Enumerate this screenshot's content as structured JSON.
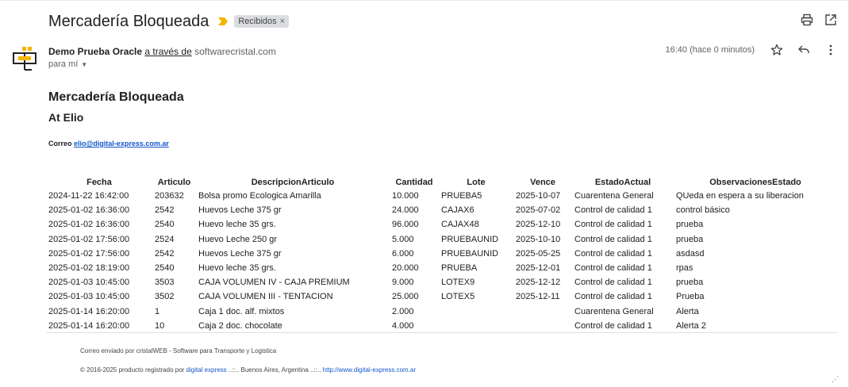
{
  "email": {
    "subject": "Mercadería Bloqueada",
    "label": "Recibidos",
    "sender_name": "Demo Prueba Oracle",
    "via_text": "a través de",
    "sender_domain": "softwarecristal.com",
    "to_text": "para mí",
    "time": "16:40 (hace 0 minutos)"
  },
  "body": {
    "title": "Mercadería Bloqueada",
    "subtitle": "At Elio",
    "contact_label": "Correo",
    "contact_email": "elio@digital-express.com.ar",
    "table": {
      "headers": [
        "Fecha",
        "Articulo",
        "DescripcionArticulo",
        "Cantidad",
        "Lote",
        "Vence",
        "EstadoActual",
        "ObservacionesEstado"
      ],
      "rows": [
        [
          "2024-11-22 16:42:00",
          "203632",
          "Bolsa promo Ecologica Amarilla",
          "10.000",
          "PRUEBA5",
          "2025-10-07",
          "Cuarentena General",
          "QUeda en espera a su liberacion"
        ],
        [
          "2025-01-02 16:36:00",
          "2542",
          "Huevos Leche 375 gr",
          "24.000",
          "CAJAX6",
          "2025-07-02",
          "Control de calidad 1",
          "control básico"
        ],
        [
          "2025-01-02 16:36:00",
          "2540",
          "Huevo leche 35 grs.",
          "96.000",
          "CAJAX48",
          "2025-12-10",
          "Control de calidad 1",
          "prueba"
        ],
        [
          "2025-01-02 17:56:00",
          "2524",
          "Huevo Leche 250 gr",
          "5.000",
          "PRUEBAUNID",
          "2025-10-10",
          "Control de calidad 1",
          "prueba"
        ],
        [
          "2025-01-02 17:56:00",
          "2542",
          "Huevos Leche 375 gr",
          "6.000",
          "PRUEBAUNID",
          "2025-05-25",
          "Control de calidad 1",
          "asdasd"
        ],
        [
          "2025-01-02 18:19:00",
          "2540",
          "Huevo leche 35 grs.",
          "20.000",
          "PRUEBA",
          "2025-12-01",
          "Control de calidad 1",
          "rpas"
        ],
        [
          "2025-01-03 10:45:00",
          "3503",
          "CAJA VOLUMEN IV - CAJA PREMIUM",
          "9.000",
          "LOTEX9",
          "2025-12-12",
          "Control de calidad 1",
          "prueba"
        ],
        [
          "2025-01-03 10:45:00",
          "3502",
          "CAJA VOLUMEN III - TENTACION",
          "25.000",
          "LOTEX5",
          "2025-12-11",
          "Control de calidad 1",
          "Prueba"
        ],
        [
          "2025-01-14 16:20:00",
          "1",
          "Caja 1 doc. alf. mixtos",
          "2.000",
          "",
          "",
          "Cuarentena General",
          "Alerta"
        ],
        [
          "2025-01-14 16:20:00",
          "10",
          "Caja 2 doc. chocolate",
          "4.000",
          "",
          "",
          "Control de calidad 1",
          "Alerta 2"
        ]
      ]
    },
    "footer_line1": "Correo enviado por cristalWEB - Software para Transporte y Logistica",
    "footer_prefix": "© 2016-2025 producto registrado por",
    "footer_link1": "digital express",
    "footer_mid": "..::.. Buenos Aires, Argentina ..::..",
    "footer_link2": "http://www.digital-express.com.ar"
  },
  "icons": {
    "importance": "importance-marker-icon",
    "print": "print-icon",
    "new_window": "open-in-new-window-icon",
    "star": "star-icon",
    "reply": "reply-icon",
    "more": "more-vert-icon"
  },
  "colors": {
    "link": "#1155cc",
    "importance": "#f4b400",
    "label_chip": "#dadce0"
  }
}
